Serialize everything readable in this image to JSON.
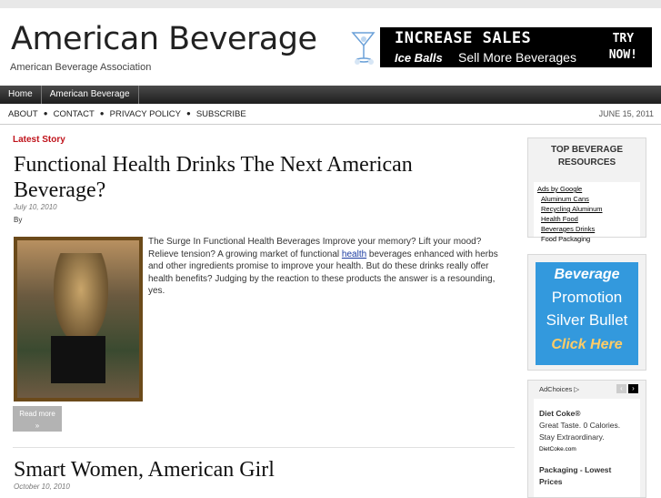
{
  "header": {
    "title": "American Beverage",
    "tagline": "American Beverage Association"
  },
  "banner": {
    "line1": "INCREASE SALES",
    "line2a": "Ice Balls",
    "line2b": "Sell More Beverages",
    "try1": "TRY",
    "try2": "NOW!"
  },
  "nav": {
    "items": [
      "Home",
      "American Beverage"
    ]
  },
  "subnav": {
    "items": [
      "ABOUT",
      "CONTACT",
      "PRIVACY POLICY",
      "SUBSCRIBE"
    ],
    "date": "JUNE 15, 2011"
  },
  "latest": {
    "label": "Latest Story"
  },
  "post": {
    "title": "Functional Health Drinks The Next American Beverage?",
    "date": "July 10, 2010",
    "by": "By",
    "excerpt_before": "The Surge In Functional Health Beverages Improve your memory? Lift your mood? Relieve tension? A growing market of functional ",
    "keyword": "health",
    "excerpt_after": " beverages enhanced with herbs and other ingredients promise to improve your health. But do these drinks really offer health benefits? Judging by the reaction to these products the answer is a resounding, yes.",
    "read_more": "Read more",
    "read_more_arrow": "»"
  },
  "post2": {
    "title": "Smart Women, American Girl",
    "date": "October 10, 2010"
  },
  "sidebar": {
    "resources": {
      "heading": "TOP BEVERAGE RESOURCES",
      "ads_by": "Ads by Google",
      "ads": [
        "Aluminum Cans",
        "Recycling Aluminum",
        "Health Food",
        "Beverages Drinks",
        "Food Packaging"
      ]
    },
    "promo": {
      "line1": "Beverage",
      "line2": "Promotion",
      "line3": "Silver Bullet",
      "line4": "Click Here"
    },
    "adbox": {
      "adchoices": "AdChoices",
      "ad1_title": "Diet Coke®",
      "ad1_line1": "Great Taste. 0 Calories.",
      "ad1_line2": "Stay Extraordinary.",
      "ad1_url": "DietCoke.com",
      "ad2_title": "Packaging - Lowest Prices"
    }
  }
}
